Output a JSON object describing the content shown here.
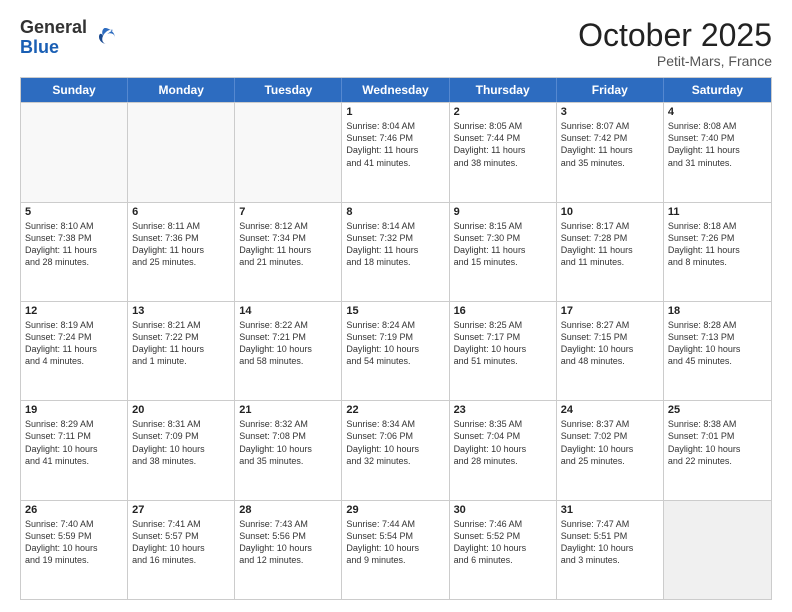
{
  "header": {
    "logo_line1": "General",
    "logo_line2": "Blue",
    "month": "October 2025",
    "location": "Petit-Mars, France"
  },
  "days_of_week": [
    "Sunday",
    "Monday",
    "Tuesday",
    "Wednesday",
    "Thursday",
    "Friday",
    "Saturday"
  ],
  "weeks": [
    [
      {
        "day": "",
        "info": ""
      },
      {
        "day": "",
        "info": ""
      },
      {
        "day": "",
        "info": ""
      },
      {
        "day": "1",
        "info": "Sunrise: 8:04 AM\nSunset: 7:46 PM\nDaylight: 11 hours\nand 41 minutes."
      },
      {
        "day": "2",
        "info": "Sunrise: 8:05 AM\nSunset: 7:44 PM\nDaylight: 11 hours\nand 38 minutes."
      },
      {
        "day": "3",
        "info": "Sunrise: 8:07 AM\nSunset: 7:42 PM\nDaylight: 11 hours\nand 35 minutes."
      },
      {
        "day": "4",
        "info": "Sunrise: 8:08 AM\nSunset: 7:40 PM\nDaylight: 11 hours\nand 31 minutes."
      }
    ],
    [
      {
        "day": "5",
        "info": "Sunrise: 8:10 AM\nSunset: 7:38 PM\nDaylight: 11 hours\nand 28 minutes."
      },
      {
        "day": "6",
        "info": "Sunrise: 8:11 AM\nSunset: 7:36 PM\nDaylight: 11 hours\nand 25 minutes."
      },
      {
        "day": "7",
        "info": "Sunrise: 8:12 AM\nSunset: 7:34 PM\nDaylight: 11 hours\nand 21 minutes."
      },
      {
        "day": "8",
        "info": "Sunrise: 8:14 AM\nSunset: 7:32 PM\nDaylight: 11 hours\nand 18 minutes."
      },
      {
        "day": "9",
        "info": "Sunrise: 8:15 AM\nSunset: 7:30 PM\nDaylight: 11 hours\nand 15 minutes."
      },
      {
        "day": "10",
        "info": "Sunrise: 8:17 AM\nSunset: 7:28 PM\nDaylight: 11 hours\nand 11 minutes."
      },
      {
        "day": "11",
        "info": "Sunrise: 8:18 AM\nSunset: 7:26 PM\nDaylight: 11 hours\nand 8 minutes."
      }
    ],
    [
      {
        "day": "12",
        "info": "Sunrise: 8:19 AM\nSunset: 7:24 PM\nDaylight: 11 hours\nand 4 minutes."
      },
      {
        "day": "13",
        "info": "Sunrise: 8:21 AM\nSunset: 7:22 PM\nDaylight: 11 hours\nand 1 minute."
      },
      {
        "day": "14",
        "info": "Sunrise: 8:22 AM\nSunset: 7:21 PM\nDaylight: 10 hours\nand 58 minutes."
      },
      {
        "day": "15",
        "info": "Sunrise: 8:24 AM\nSunset: 7:19 PM\nDaylight: 10 hours\nand 54 minutes."
      },
      {
        "day": "16",
        "info": "Sunrise: 8:25 AM\nSunset: 7:17 PM\nDaylight: 10 hours\nand 51 minutes."
      },
      {
        "day": "17",
        "info": "Sunrise: 8:27 AM\nSunset: 7:15 PM\nDaylight: 10 hours\nand 48 minutes."
      },
      {
        "day": "18",
        "info": "Sunrise: 8:28 AM\nSunset: 7:13 PM\nDaylight: 10 hours\nand 45 minutes."
      }
    ],
    [
      {
        "day": "19",
        "info": "Sunrise: 8:29 AM\nSunset: 7:11 PM\nDaylight: 10 hours\nand 41 minutes."
      },
      {
        "day": "20",
        "info": "Sunrise: 8:31 AM\nSunset: 7:09 PM\nDaylight: 10 hours\nand 38 minutes."
      },
      {
        "day": "21",
        "info": "Sunrise: 8:32 AM\nSunset: 7:08 PM\nDaylight: 10 hours\nand 35 minutes."
      },
      {
        "day": "22",
        "info": "Sunrise: 8:34 AM\nSunset: 7:06 PM\nDaylight: 10 hours\nand 32 minutes."
      },
      {
        "day": "23",
        "info": "Sunrise: 8:35 AM\nSunset: 7:04 PM\nDaylight: 10 hours\nand 28 minutes."
      },
      {
        "day": "24",
        "info": "Sunrise: 8:37 AM\nSunset: 7:02 PM\nDaylight: 10 hours\nand 25 minutes."
      },
      {
        "day": "25",
        "info": "Sunrise: 8:38 AM\nSunset: 7:01 PM\nDaylight: 10 hours\nand 22 minutes."
      }
    ],
    [
      {
        "day": "26",
        "info": "Sunrise: 7:40 AM\nSunset: 5:59 PM\nDaylight: 10 hours\nand 19 minutes."
      },
      {
        "day": "27",
        "info": "Sunrise: 7:41 AM\nSunset: 5:57 PM\nDaylight: 10 hours\nand 16 minutes."
      },
      {
        "day": "28",
        "info": "Sunrise: 7:43 AM\nSunset: 5:56 PM\nDaylight: 10 hours\nand 12 minutes."
      },
      {
        "day": "29",
        "info": "Sunrise: 7:44 AM\nSunset: 5:54 PM\nDaylight: 10 hours\nand 9 minutes."
      },
      {
        "day": "30",
        "info": "Sunrise: 7:46 AM\nSunset: 5:52 PM\nDaylight: 10 hours\nand 6 minutes."
      },
      {
        "day": "31",
        "info": "Sunrise: 7:47 AM\nSunset: 5:51 PM\nDaylight: 10 hours\nand 3 minutes."
      },
      {
        "day": "",
        "info": ""
      }
    ]
  ]
}
